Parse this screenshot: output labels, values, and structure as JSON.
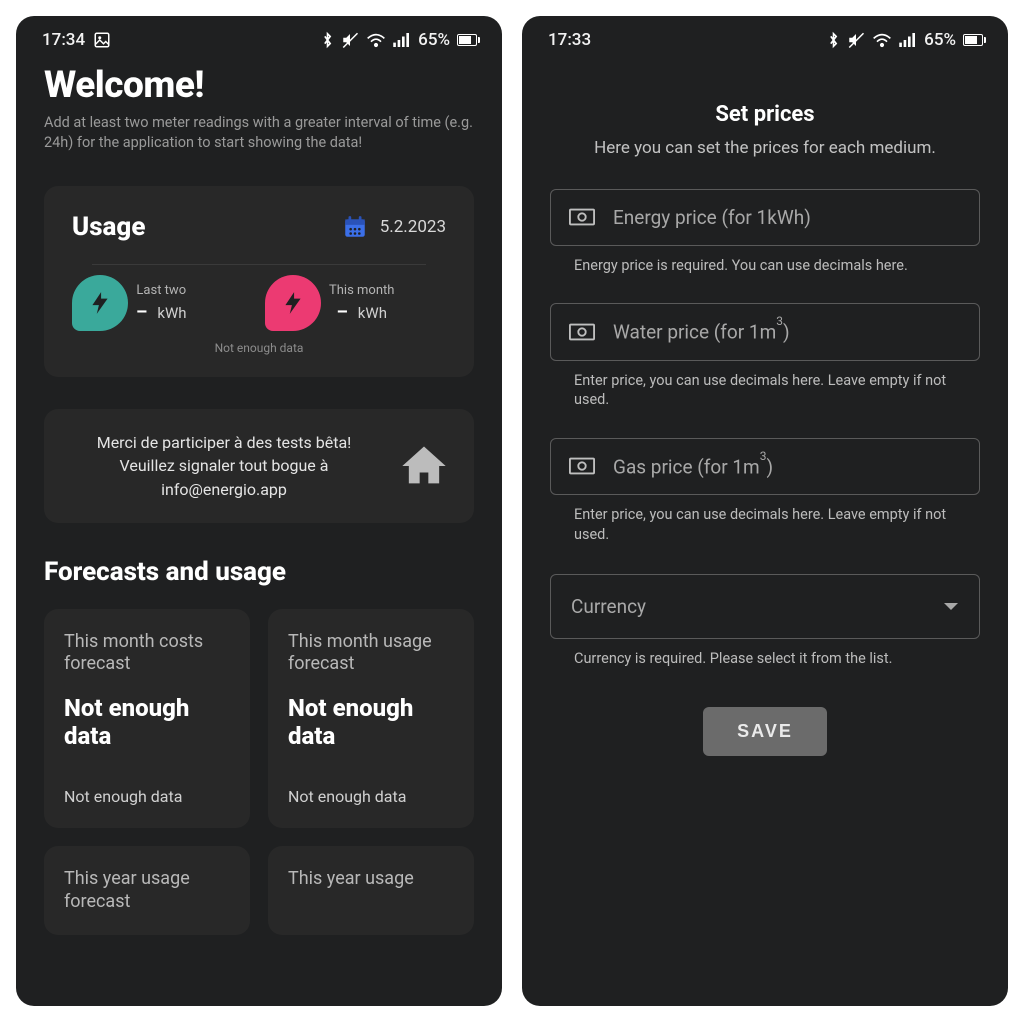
{
  "left": {
    "status": {
      "time": "17:34",
      "battery": "65%"
    },
    "welcome": {
      "title": "Welcome!",
      "subtitle": "Add at least two meter readings with a greater interval of time (e.g. 24h) for the application to start showing the data!"
    },
    "usage": {
      "title": "Usage",
      "date": "5.2.2023",
      "col1": {
        "label": "Last two",
        "value": "–",
        "unit": "kWh",
        "note": "Not enough data"
      },
      "col2": {
        "label": "This month",
        "value": "–",
        "unit": "kWh"
      }
    },
    "beta": {
      "text": "Merci de participer à des tests bêta! Veuillez signaler tout bogue à info@energio.app"
    },
    "forecasts": {
      "title": "Forecasts and usage",
      "cards": [
        {
          "label": "This month costs forecast",
          "main": "Not enough data",
          "sub": "Not enough data"
        },
        {
          "label": "This month usage forecast",
          "main": "Not enough data",
          "sub": "Not enough data"
        },
        {
          "label": "This year usage forecast",
          "main": "",
          "sub": ""
        },
        {
          "label": "This year usage",
          "main": "",
          "sub": ""
        }
      ]
    }
  },
  "right": {
    "status": {
      "time": "17:33",
      "battery": "65%"
    },
    "prices": {
      "title": "Set prices",
      "subtitle": "Here you can set the prices for each medium.",
      "fields": [
        {
          "placeholder": "Energy price (for 1kWh)",
          "helper": "Energy price is required. You can use decimals here."
        },
        {
          "placeholder_html": "Water price (for 1m³)",
          "helper": "Enter price, you can use decimals here. Leave empty if not used."
        },
        {
          "placeholder_html": "Gas price (for 1m³)",
          "helper": "Enter price, you can use decimals here. Leave empty if not used."
        }
      ],
      "currency": {
        "label": "Currency",
        "helper": "Currency is required. Please select it from the list."
      },
      "save": "SAVE"
    }
  }
}
